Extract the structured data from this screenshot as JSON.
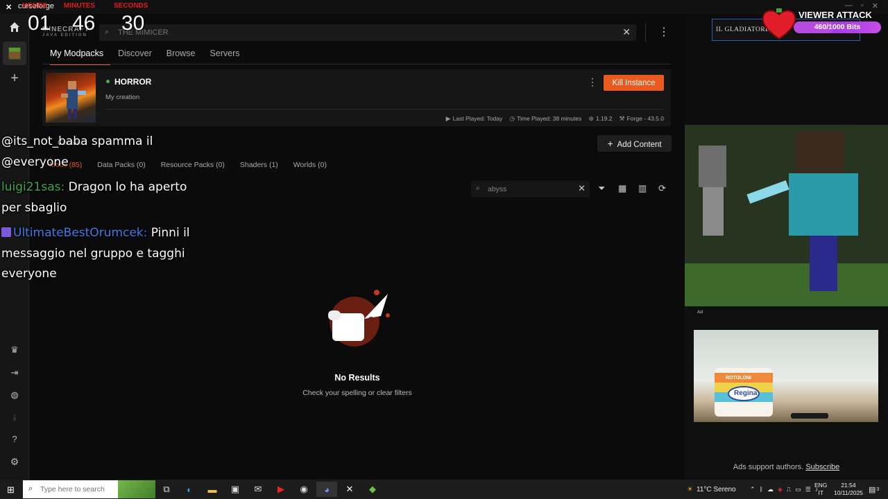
{
  "titlebar": {
    "app_name": "curseforge"
  },
  "timer": {
    "labels": [
      "HOURS",
      "MINUTES",
      "SECONDS"
    ],
    "values": [
      "01",
      "46",
      "30"
    ]
  },
  "header": {
    "game_logo": "MINECRAFT",
    "game_logo_sub": "JAVA EDITION",
    "search_placeholder": "THE MIMICER"
  },
  "nav": {
    "tabs": [
      {
        "label": "My Modpacks",
        "active": true
      },
      {
        "label": "Discover",
        "active": false
      },
      {
        "label": "Browse",
        "active": false
      },
      {
        "label": "Servers",
        "active": false
      }
    ]
  },
  "modpack": {
    "name": "HORROR",
    "subtitle": "My creation",
    "kill_label": "Kill Instance",
    "last_played": "Last Played: Today",
    "time_played": "Time Played: 38 minutes",
    "version": "1.19.2",
    "loader": "Forge - 43.5.0"
  },
  "content": {
    "label": "Content",
    "add_label": "Add Content",
    "tabs": [
      {
        "label": "Mods (85)",
        "active": true
      },
      {
        "label": "Data Packs (0)",
        "active": false
      },
      {
        "label": "Resource Packs (0)",
        "active": false
      },
      {
        "label": "Shaders (1)",
        "active": false
      },
      {
        "label": "Worlds (0)",
        "active": false
      }
    ],
    "search_value": "abyss",
    "empty_title": "No Results",
    "empty_sub": "Check your spelling or clear filters"
  },
  "chat": [
    {
      "user": "@its_not_baba",
      "text": "spamma il @everyone"
    },
    {
      "user": "luigi21sas:",
      "text": "Dragon lo ha aperto per sbaglio"
    },
    {
      "user": "UltimateBestOrumcek:",
      "text": "Pinni il messaggio nel gruppo e tagghi everyone"
    }
  ],
  "viewer_attack": {
    "title": "VIEWER ATTACK",
    "bits": "460/1000 Bits",
    "progress": 0.46
  },
  "sponsor": {
    "name": "IL GLADIATORE"
  },
  "ad": {
    "tag": "Ad",
    "product_brand": "ROTOLONI",
    "product_name": "Regina",
    "support_text": "Ads support authors.",
    "subscribe_label": "Subscribe"
  },
  "taskbar": {
    "search_placeholder": "Type here to search",
    "weather": "11°C  Sereno",
    "lang_top": "ENG",
    "lang_bottom": "IT",
    "time": "21:54",
    "date": "10/11/2025",
    "notif_count": "3"
  },
  "colors": {
    "accent": "#e8572a",
    "kill": "#e85a1d",
    "online": "#4caf50",
    "bits_bar": "#8a2be2"
  }
}
